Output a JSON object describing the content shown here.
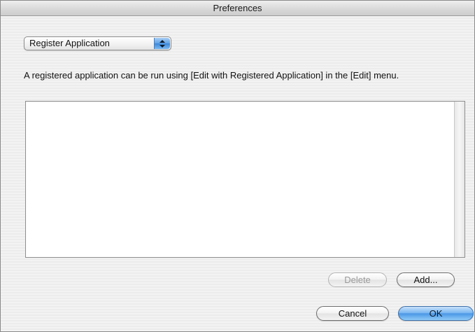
{
  "window": {
    "title": "Preferences"
  },
  "category_popup": {
    "selected": "Register Application"
  },
  "description": "A registered application can be run using [Edit with Registered Application] in the [Edit] menu.",
  "registered_apps": [],
  "buttons": {
    "delete_label": "Delete",
    "add_label": "Add...",
    "cancel_label": "Cancel",
    "ok_label": "OK"
  },
  "colors": {
    "default_button": "#6aaef0",
    "window_background": "#eeeeee"
  }
}
